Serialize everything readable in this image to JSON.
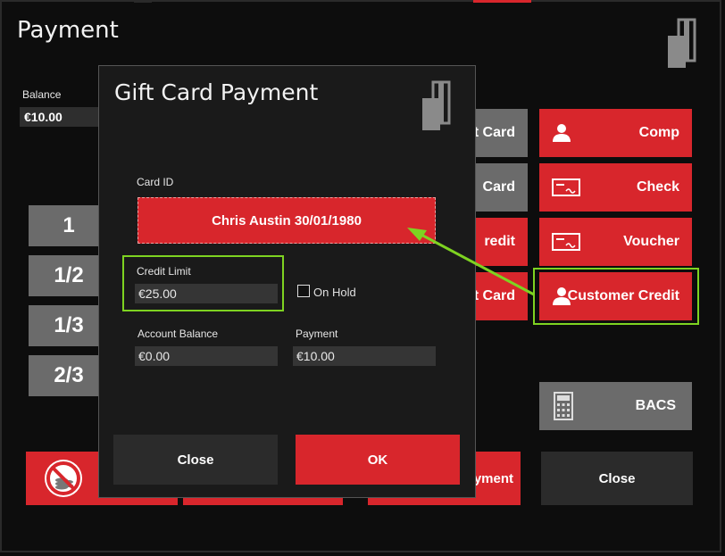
{
  "window": {
    "title": "Payment",
    "balance_label": "Balance",
    "balance_value": "€10.00"
  },
  "numpad": [
    "1",
    "1/2",
    "1/3",
    "2/3"
  ],
  "tenders_left": [
    {
      "label": "t Card"
    },
    {
      "label": "Card"
    },
    {
      "label": "redit"
    },
    {
      "label": "t Card"
    }
  ],
  "tenders_right": [
    {
      "label": "Comp",
      "icon": "user-icon"
    },
    {
      "label": "Check",
      "icon": "check-icon"
    },
    {
      "label": "Voucher",
      "icon": "voucher-icon"
    },
    {
      "label": "Customer Credit",
      "icon": "user-icon"
    }
  ],
  "bacs": {
    "label": "BACS",
    "icon": "calculator-icon"
  },
  "bottom": {
    "payment_label": "yment",
    "close_label": "Close"
  },
  "dialog": {
    "title": "Gift Card Payment",
    "card_id_label": "Card ID",
    "card_id_value": "Chris Austin 30/01/1980",
    "credit_limit_label": "Credit Limit",
    "credit_limit_value": "€25.00",
    "on_hold_label": "On Hold",
    "on_hold_checked": false,
    "account_balance_label": "Account Balance",
    "account_balance_value": "€0.00",
    "payment_label": "Payment",
    "payment_value": "€10.00",
    "close_label": "Close",
    "ok_label": "OK"
  },
  "colors": {
    "accent_red": "#d8262c",
    "grey": "#6b6b6b",
    "highlight": "#7ed321"
  }
}
